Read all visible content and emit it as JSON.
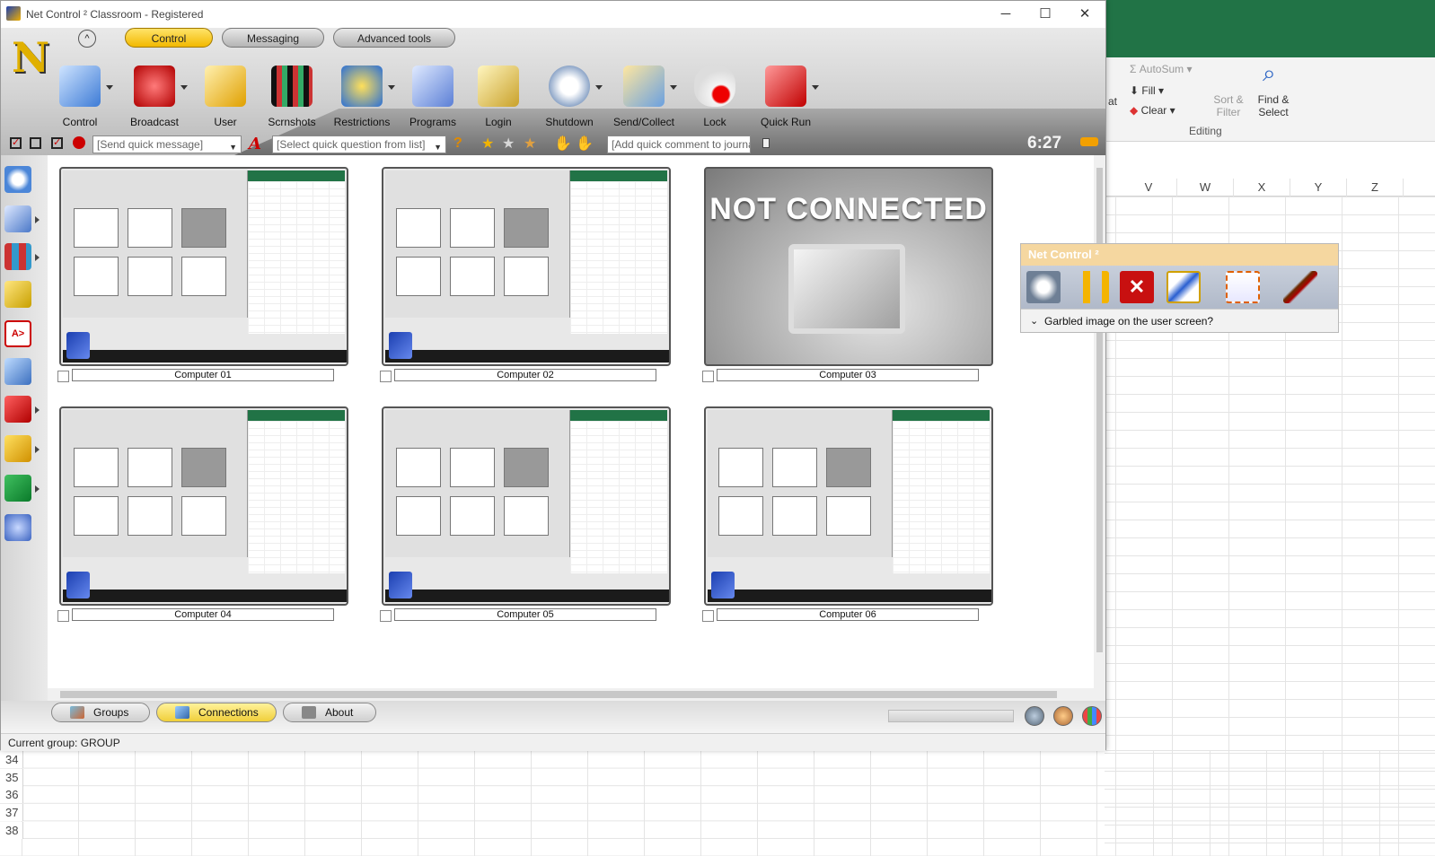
{
  "window": {
    "title": "Net Control ² Classroom - Registered",
    "controls": {
      "minimize": "─",
      "maximize": "☐",
      "close": "✕"
    }
  },
  "tabs": [
    {
      "label": "Control",
      "active": true
    },
    {
      "label": "Messaging",
      "active": false
    },
    {
      "label": "Advanced tools",
      "active": false
    }
  ],
  "toolbar": [
    {
      "label": "Control",
      "icon": "monitor-icon"
    },
    {
      "label": "Broadcast",
      "icon": "broadcast-icon"
    },
    {
      "label": "User",
      "icon": "user-icon"
    },
    {
      "label": "Scrnshots",
      "icon": "screenshots-icon"
    },
    {
      "label": "Restrictions",
      "icon": "restrictions-icon"
    },
    {
      "label": "Programs",
      "icon": "programs-icon"
    },
    {
      "label": "Login",
      "icon": "login-icon"
    },
    {
      "label": "Shutdown",
      "icon": "shutdown-icon"
    },
    {
      "label": "Send/Collect",
      "icon": "send-collect-icon"
    },
    {
      "label": "Lock",
      "icon": "lock-mouse-icon"
    },
    {
      "label": "Quick Run",
      "icon": "quick-run-icon"
    }
  ],
  "quickbar": {
    "message_placeholder": "[Send quick message]",
    "question_placeholder": "[Select quick question from list]",
    "journal_placeholder": "[Add quick comment to journal]",
    "clock": "6:27"
  },
  "computers": [
    {
      "label": "Computer 01",
      "connected": true
    },
    {
      "label": "Computer 02",
      "connected": true
    },
    {
      "label": "Computer 03",
      "connected": false
    },
    {
      "label": "Computer 04",
      "connected": true
    },
    {
      "label": "Computer 05",
      "connected": true
    },
    {
      "label": "Computer 06",
      "connected": true
    }
  ],
  "not_connected_text": "NOT CONNECTED",
  "bottom_tabs": [
    {
      "label": "Groups",
      "active": false
    },
    {
      "label": "Connections",
      "active": true
    },
    {
      "label": "About",
      "active": false
    }
  ],
  "status": "Current group: GROUP",
  "floating_toolbar": {
    "title": "Net Control ²",
    "tooltip": "Garbled image on the user screen?"
  },
  "excel": {
    "autosum": "AutoSum",
    "fill": "Fill",
    "clear": "Clear",
    "sort_filter": "Sort & Filter",
    "find_select": "Find & Select",
    "group_label": "Editing",
    "partial_label": "at",
    "columns": [
      "V",
      "W",
      "X",
      "Y",
      "Z"
    ],
    "rows": [
      "34",
      "35",
      "36",
      "37",
      "38"
    ]
  }
}
